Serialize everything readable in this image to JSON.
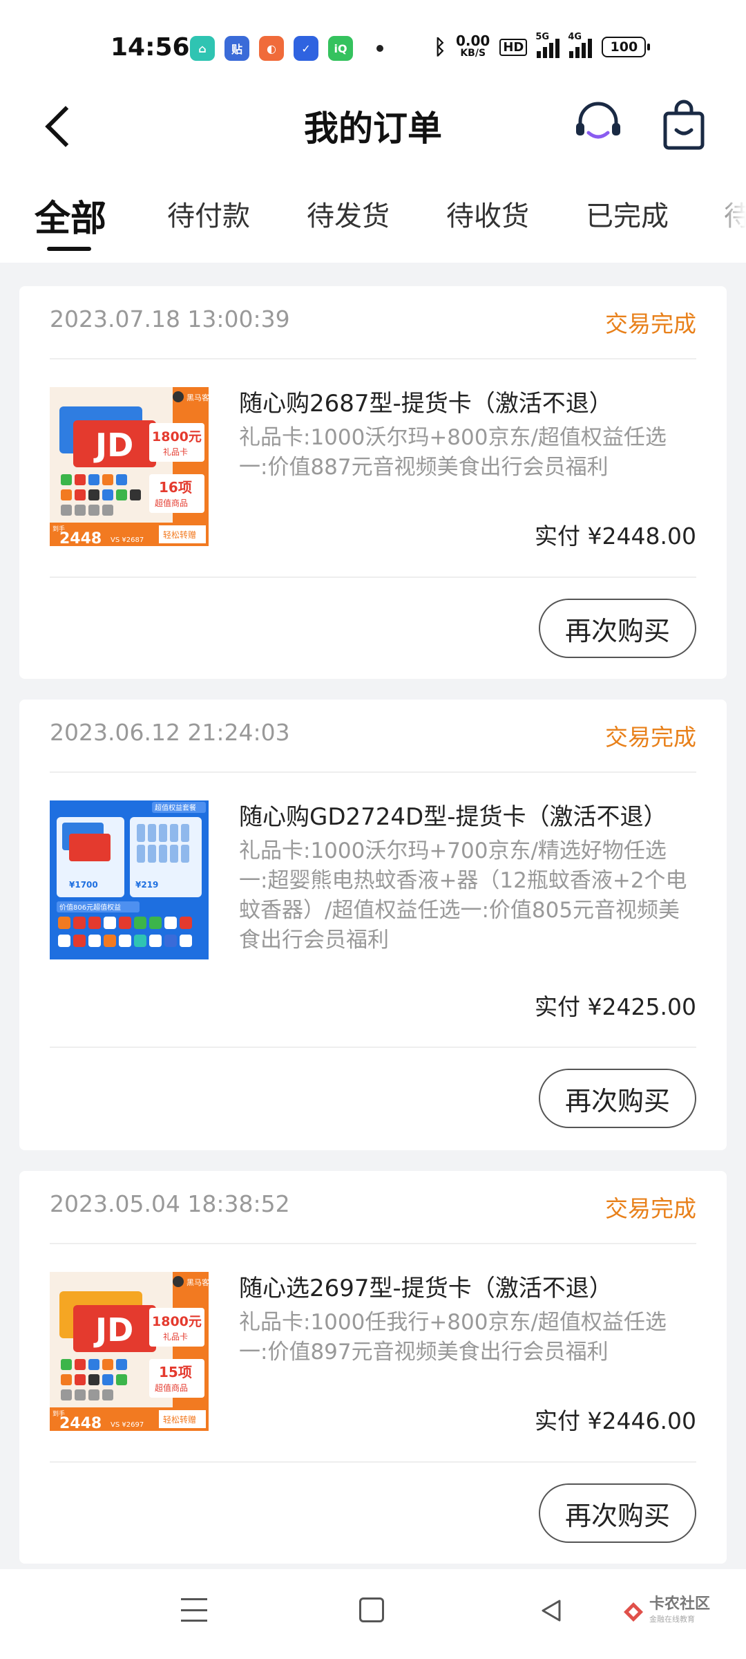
{
  "status_bar": {
    "time": "14:56",
    "apps": [
      {
        "name": "home-app-icon",
        "glyph": "⌂",
        "color": "#2fc4b2"
      },
      {
        "name": "tieba-app-icon",
        "glyph": "贴",
        "color": "#3a6bd8"
      },
      {
        "name": "browser-app-icon",
        "glyph": "◐",
        "color": "#f06b3a"
      },
      {
        "name": "shield-app-icon",
        "glyph": "✓",
        "color": "#2f63e0"
      },
      {
        "name": "iqiyi-app-icon",
        "glyph": "iQ",
        "color": "#35c25e"
      }
    ],
    "net_speed": "0.00",
    "net_unit": "KB/S",
    "hd": "HD",
    "sig1": "5G",
    "sig2": "4G",
    "battery": "100"
  },
  "header": {
    "title": "我的订单"
  },
  "tabs": [
    "全部",
    "待付款",
    "待发货",
    "待收货",
    "已完成",
    "待"
  ],
  "orders": [
    {
      "date": "2023.07.18 13:00:39",
      "status": "交易完成",
      "name": "随心购2687型-提货卡（激活不退）",
      "desc": "礼品卡:1000沃尔玛+800京东/超值权益任选一:价值887元音视频美食出行会员福利",
      "paid": "实付 ¥2448.00",
      "rebuy": "再次购买",
      "thumb": {
        "brand": "黑马客",
        "card_amount": "1800元",
        "card_label": "礼品卡",
        "count": "16项",
        "count_label": "超值商品",
        "price_label": "到手",
        "price": "2448",
        "vs": "VS ¥2687",
        "slogan": "轻松转赠",
        "accent": "#f27a21"
      }
    },
    {
      "date": "2023.06.12 21:24:03",
      "status": "交易完成",
      "name": "随心购GD2724D型-提货卡（激活不退）",
      "desc": "礼品卡:1000沃尔玛+700京东/精选好物任选一:超婴熊电热蚊香液+器（12瓶蚊香液+2个电蚊香器）/超值权益任选一:价值805元音视频美食出行会员福利",
      "paid": "实付 ¥2425.00",
      "rebuy": "再次购买",
      "thumb": {
        "tag": "超值权益套餐",
        "card_value": "¥1700",
        "gift_value": "¥219",
        "benefit": "价值806元超值权益",
        "accent": "#1e6fe0"
      }
    },
    {
      "date": "2023.05.04 18:38:52",
      "status": "交易完成",
      "name": "随心选2697型-提货卡（激活不退）",
      "desc": "礼品卡:1000任我行+800京东/超值权益任选一:价值897元音视频美食出行会员福利",
      "paid": "实付 ¥2446.00",
      "rebuy": "再次购买",
      "thumb": {
        "brand": "黑马客",
        "card_amount": "1800元",
        "card_label": "礼品卡",
        "count": "15项",
        "count_label": "超值商品",
        "price_label": "到手",
        "price": "2448",
        "vs": "VS ¥2697",
        "slogan": "轻松转赠",
        "accent": "#f27a21"
      }
    }
  ],
  "watermark": {
    "main": "卡农社区",
    "sub": "金融在线教育"
  }
}
